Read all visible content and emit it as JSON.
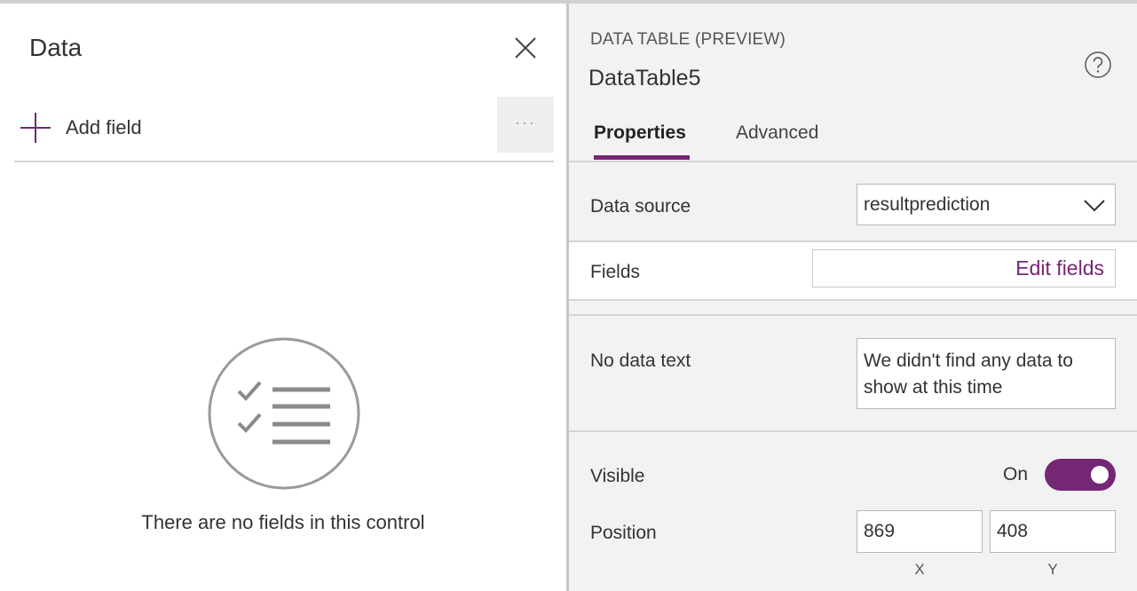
{
  "left_panel": {
    "title": "Data",
    "add_field_label": "Add field",
    "more_label": "···",
    "empty_message": "There are no fields in this control"
  },
  "right_panel": {
    "control_type": "DATA TABLE (PREVIEW)",
    "control_name": "DataTable5",
    "tabs": [
      {
        "label": "Properties",
        "active": true
      },
      {
        "label": "Advanced",
        "active": false
      }
    ],
    "properties": {
      "data_source": {
        "label": "Data source",
        "value": "resultprediction"
      },
      "fields": {
        "label": "Fields",
        "button": "Edit fields"
      },
      "no_data_text": {
        "label": "No data text",
        "value": "We didn't find any data to show at this time"
      },
      "visible": {
        "label": "Visible",
        "state": "On",
        "on": true
      },
      "position": {
        "label": "Position",
        "x": "869",
        "y": "408",
        "x_label": "X",
        "y_label": "Y"
      }
    }
  },
  "colors": {
    "accent": "#742774",
    "panel_bg": "#f2f2f2",
    "divider": "#d4d4d4"
  },
  "icons": [
    "close-icon",
    "plus-icon",
    "more-icon",
    "checklist-icon",
    "help-icon",
    "chevron-down-icon"
  ]
}
